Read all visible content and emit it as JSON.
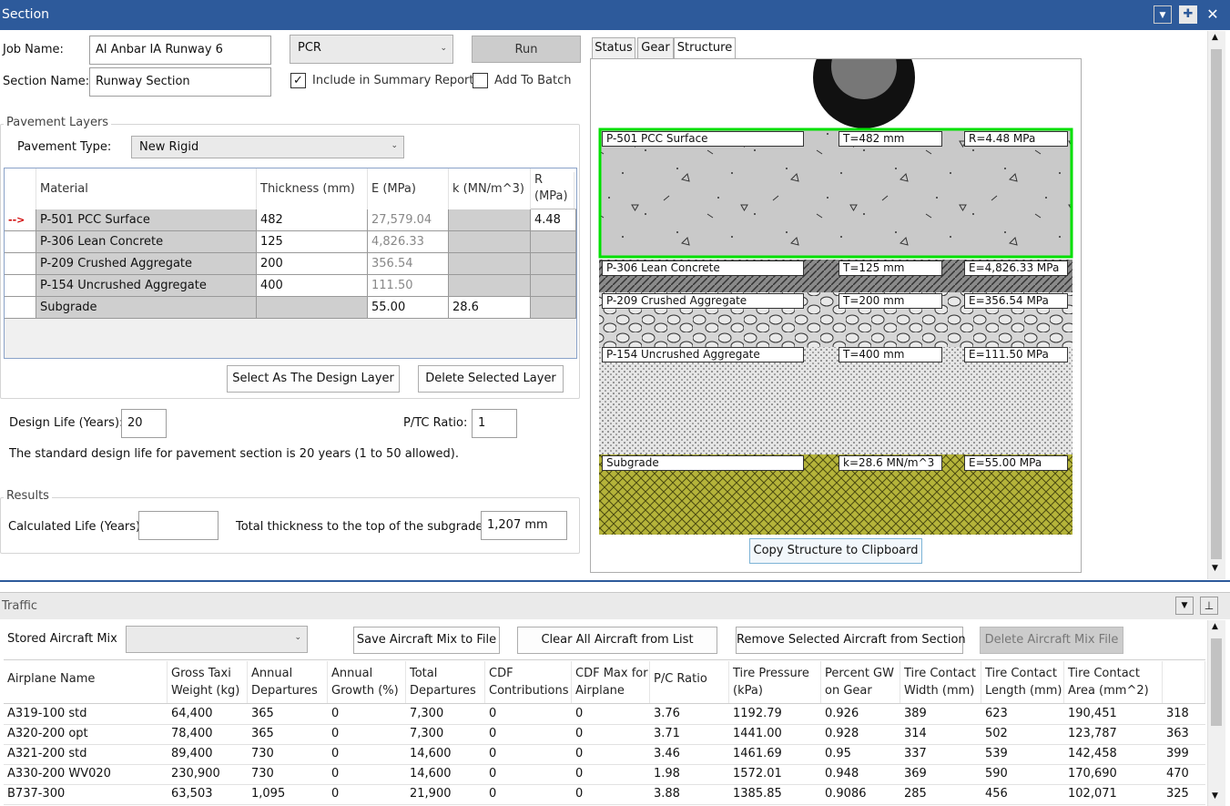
{
  "window": {
    "title": "Section"
  },
  "form": {
    "job_name_label": "Job Name:",
    "job_name_value": "Al Anbar IA Runway 6",
    "section_name_label": "Section Name:",
    "section_name_value": "Runway Section",
    "method_value": "PCR",
    "run_label": "Run",
    "include_summary_label": "Include in Summary Report",
    "include_summary_checked": "✓",
    "add_to_batch_label": "Add To Batch"
  },
  "pavement_layers": {
    "group_title": "Pavement Layers",
    "type_label": "Pavement Type:",
    "type_value": "New Rigid",
    "columns": [
      "Material",
      "Thickness (mm)",
      "E (MPa)",
      "k (MN/m^3)",
      "R (MPa)"
    ],
    "row_marker": "-->",
    "rows": [
      {
        "material": "P-501 PCC Surface",
        "thickness": "482",
        "e": "27,579.04",
        "k": "",
        "r": "4.48"
      },
      {
        "material": "P-306 Lean Concrete",
        "thickness": "125",
        "e": "4,826.33",
        "k": "",
        "r": ""
      },
      {
        "material": "P-209 Crushed Aggregate",
        "thickness": "200",
        "e": "356.54",
        "k": "",
        "r": ""
      },
      {
        "material": "P-154 Uncrushed Aggregate",
        "thickness": "400",
        "e": "111.50",
        "k": "",
        "r": ""
      },
      {
        "material": "Subgrade",
        "thickness": "",
        "e": "55.00",
        "k": "28.6",
        "r": ""
      }
    ],
    "select_design_label": "Select As The Design Layer",
    "delete_layer_label": "Delete Selected Layer"
  },
  "design": {
    "life_label": "Design Life (Years):",
    "life_value": "20",
    "ptc_label": "P/TC Ratio:",
    "ptc_value": "1",
    "note": "The standard design life for pavement section is 20 years (1 to 50 allowed)."
  },
  "results": {
    "group_title": "Results",
    "calc_life_label": "Calculated Life (Years):",
    "calc_life_value": "",
    "total_thickness_label": "Total thickness to the top of the subgrade:",
    "total_thickness_value": "1,207 mm"
  },
  "tabs": [
    "Status",
    "Gear",
    "Structure"
  ],
  "structure": {
    "layers": [
      {
        "name": "P-501 PCC Surface",
        "thick": "T=482 mm",
        "mod": "R=4.48 MPa"
      },
      {
        "name": "P-306 Lean Concrete",
        "thick": "T=125 mm",
        "mod": "E=4,826.33 MPa"
      },
      {
        "name": "P-209 Crushed Aggregate",
        "thick": "T=200 mm",
        "mod": "E=356.54 MPa"
      },
      {
        "name": "P-154 Uncrushed Aggregate",
        "thick": "T=400 mm",
        "mod": "E=111.50 MPa"
      },
      {
        "name": "Subgrade",
        "thick": "k=28.6 MN/m^3",
        "mod": "E=55.00 MPa"
      }
    ],
    "copy_label": "Copy Structure to Clipboard",
    "colors": {
      "selected_outline": "#00e000",
      "pcc": "#c9c9c9",
      "lean": "#8a8a8a",
      "subgrade": "#b5b43a"
    }
  },
  "traffic": {
    "title": "Traffic",
    "stored_mix_label": "Stored Aircraft Mix",
    "stored_mix_value": "",
    "save_mix_label": "Save Aircraft Mix to File",
    "clear_all_label": "Clear All Aircraft from List",
    "remove_selected_label": "Remove Selected Aircraft from Section",
    "delete_mix_label": "Delete Aircraft Mix File",
    "columns": [
      [
        "Airplane Name"
      ],
      [
        "Gross Taxi",
        "Weight (kg)"
      ],
      [
        "Annual",
        "Departures"
      ],
      [
        "Annual",
        "Growth (%)"
      ],
      [
        "Total",
        "Departures"
      ],
      [
        "CDF",
        "Contributions"
      ],
      [
        "CDF Max for",
        "Airplane"
      ],
      [
        "P/C Ratio"
      ],
      [
        "Tire Pressure",
        "(kPa)"
      ],
      [
        "Percent GW",
        "on Gear"
      ],
      [
        "Tire Contact",
        "Width (mm)"
      ],
      [
        "Tire Contact",
        "Length (mm)"
      ],
      [
        "Tire Contact",
        "Area (mm^2)"
      ],
      [
        ""
      ]
    ],
    "rows": [
      [
        "A319-100 std",
        "64,400",
        "365",
        "0",
        "7,300",
        "0",
        "0",
        "3.76",
        "1192.79",
        "0.926",
        "389",
        "623",
        "190,451",
        "318"
      ],
      [
        "A320-200 opt",
        "78,400",
        "365",
        "0",
        "7,300",
        "0",
        "0",
        "3.71",
        "1441.00",
        "0.928",
        "314",
        "502",
        "123,787",
        "363"
      ],
      [
        "A321-200 std",
        "89,400",
        "730",
        "0",
        "14,600",
        "0",
        "0",
        "3.46",
        "1461.69",
        "0.95",
        "337",
        "539",
        "142,458",
        "399"
      ],
      [
        "A330-200 WV020",
        "230,900",
        "730",
        "0",
        "14,600",
        "0",
        "0",
        "1.98",
        "1572.01",
        "0.948",
        "369",
        "590",
        "170,690",
        "470"
      ],
      [
        "B737-300",
        "63,503",
        "1,095",
        "0",
        "21,900",
        "0",
        "0",
        "3.88",
        "1385.85",
        "0.9086",
        "285",
        "456",
        "102,071",
        "325"
      ]
    ]
  }
}
